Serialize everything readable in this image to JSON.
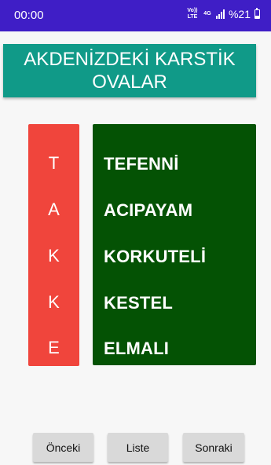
{
  "status_bar": {
    "time": "00:00",
    "volte_label": "Vo)) LTE",
    "network_label": "4G",
    "battery_text": "%21"
  },
  "title": "AKDENİZDEKİ KARSTİK OVALAR",
  "letters": [
    "T",
    "A",
    "K",
    "K",
    "E"
  ],
  "words": [
    "TEFENNİ",
    "ACIPAYAM",
    "KORKUTELİ",
    "KESTEL",
    "ELMALI"
  ],
  "buttons": {
    "previous": "Önceki",
    "list": "Liste",
    "next": "Sonraki"
  },
  "colors": {
    "status_bar": "#3f1ec6",
    "title_banner": "#109a88",
    "letters_panel": "#f0453c",
    "words_panel": "#045204",
    "button": "#d9d9d9"
  }
}
